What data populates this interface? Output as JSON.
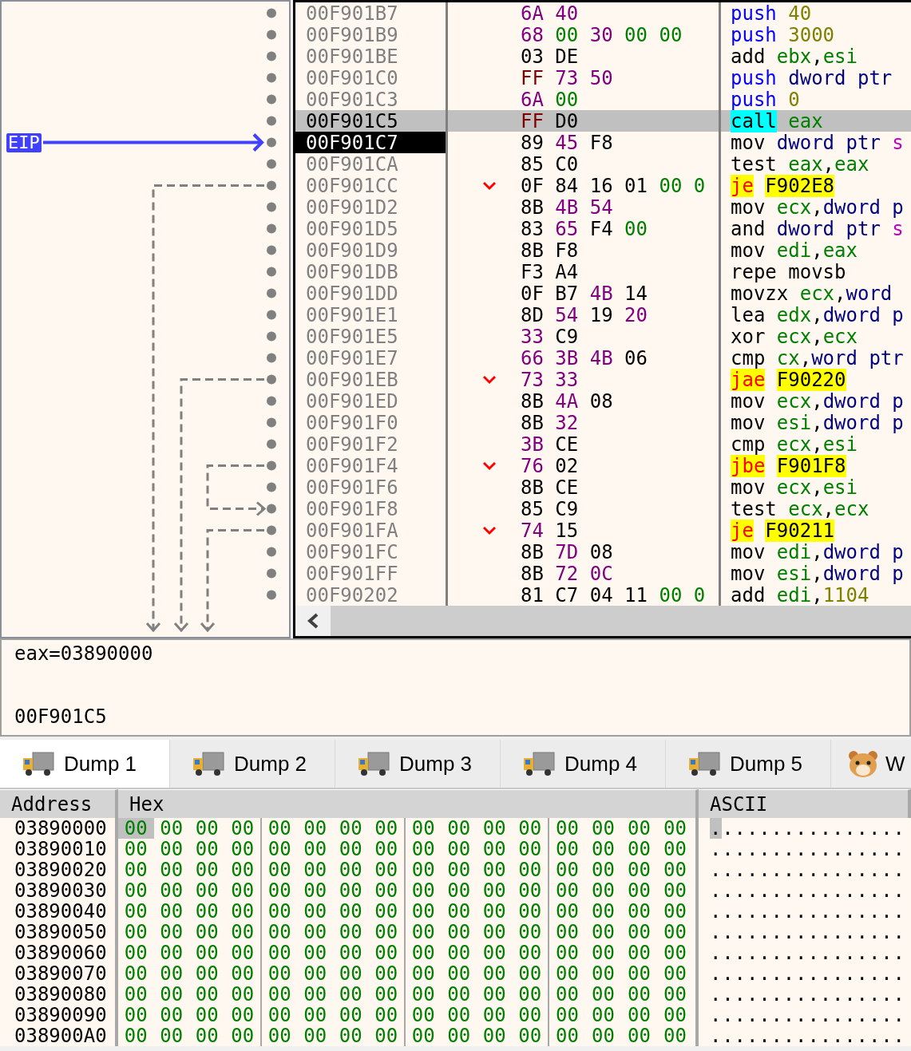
{
  "gutter": {
    "eip_label": "EIP"
  },
  "disassembly": {
    "rows": [
      {
        "address": "00F901B7",
        "selected": false,
        "eip": false,
        "jump": false,
        "bytes": [
          {
            "text": "6A",
            "color": "#800080"
          },
          {
            "text": "40",
            "color": "#800080"
          }
        ],
        "instruction": [
          [
            {
              "text": "push",
              "color": "#0000ff"
            }
          ],
          [
            {
              "text": "40",
              "color": "#808000"
            }
          ]
        ]
      },
      {
        "address": "00F901B9",
        "selected": false,
        "eip": false,
        "jump": false,
        "bytes": [
          {
            "text": "68",
            "color": "#800080"
          },
          {
            "text": "00",
            "color": "#008000"
          },
          {
            "text": "30",
            "color": "#800080"
          },
          {
            "text": "00",
            "color": "#008000"
          },
          {
            "text": "00",
            "color": "#008000"
          }
        ],
        "instruction": [
          [
            {
              "text": "push",
              "color": "#0000ff"
            }
          ],
          [
            {
              "text": "3000",
              "color": "#808000"
            }
          ]
        ]
      },
      {
        "address": "00F901BE",
        "selected": false,
        "eip": false,
        "jump": false,
        "bytes": [
          {
            "text": "03",
            "color": "#000000"
          },
          {
            "text": "DE",
            "color": "#000000"
          }
        ],
        "instruction": [
          [
            {
              "text": "add",
              "color": "#000000"
            }
          ],
          [
            {
              "text": "ebx",
              "color": "#008000"
            },
            {
              "text": ",",
              "color": "#000000"
            },
            {
              "text": "esi",
              "color": "#008000"
            }
          ]
        ]
      },
      {
        "address": "00F901C0",
        "selected": false,
        "eip": false,
        "jump": false,
        "bytes": [
          {
            "text": "FF",
            "color": "#800000"
          },
          {
            "text": "73",
            "color": "#800080"
          },
          {
            "text": "50",
            "color": "#800080"
          }
        ],
        "instruction": [
          [
            {
              "text": "push",
              "color": "#0000ff"
            }
          ],
          [
            {
              "text": "dword",
              "color": "#000080"
            }
          ],
          [
            {
              "text": "ptr",
              "color": "#000080"
            }
          ]
        ]
      },
      {
        "address": "00F901C3",
        "selected": false,
        "eip": false,
        "jump": false,
        "bytes": [
          {
            "text": "6A",
            "color": "#800080"
          },
          {
            "text": "00",
            "color": "#008000"
          }
        ],
        "instruction": [
          [
            {
              "text": "push",
              "color": "#0000ff"
            }
          ],
          [
            {
              "text": "0",
              "color": "#808000"
            }
          ]
        ]
      },
      {
        "address": "00F901C5",
        "selected": true,
        "eip": false,
        "jump": false,
        "bytes": [
          {
            "text": "FF",
            "color": "#800000"
          },
          {
            "text": "D0",
            "color": "#000000"
          }
        ],
        "instruction": [
          [
            {
              "text": "call",
              "kind": "call"
            }
          ],
          [
            {
              "text": "eax",
              "color": "#008000"
            }
          ]
        ]
      },
      {
        "address": "00F901C7",
        "selected": false,
        "eip": true,
        "jump": false,
        "bytes": [
          {
            "text": "89",
            "color": "#000000"
          },
          {
            "text": "45",
            "color": "#800080"
          },
          {
            "text": "F8",
            "color": "#000000"
          }
        ],
        "instruction": [
          [
            {
              "text": "mov",
              "color": "#000000"
            }
          ],
          [
            {
              "text": "dword",
              "color": "#000080"
            }
          ],
          [
            {
              "text": "ptr",
              "color": "#000080"
            }
          ],
          [
            {
              "text": "s",
              "color": "#c000c0"
            }
          ]
        ]
      },
      {
        "address": "00F901CA",
        "selected": false,
        "eip": false,
        "jump": false,
        "bytes": [
          {
            "text": "85",
            "color": "#000000"
          },
          {
            "text": "C0",
            "color": "#000000"
          }
        ],
        "instruction": [
          [
            {
              "text": "test",
              "color": "#000000"
            }
          ],
          [
            {
              "text": "eax",
              "color": "#008000"
            },
            {
              "text": ",",
              "color": "#000000"
            },
            {
              "text": "eax",
              "color": "#008000"
            }
          ]
        ]
      },
      {
        "address": "00F901CC",
        "selected": false,
        "eip": false,
        "jump": true,
        "bytes": [
          {
            "text": "0F",
            "color": "#000000"
          },
          {
            "text": "84",
            "color": "#000000"
          },
          {
            "text": "16",
            "color": "#000000"
          },
          {
            "text": "01",
            "color": "#000000"
          },
          {
            "text": "00",
            "color": "#008000"
          },
          {
            "text": "0",
            "color": "#008000"
          }
        ],
        "instruction": [
          [
            {
              "text": "je",
              "kind": "jump"
            }
          ],
          [
            {
              "text": "F902E8",
              "kind": "target"
            }
          ]
        ]
      },
      {
        "address": "00F901D2",
        "selected": false,
        "eip": false,
        "jump": false,
        "bytes": [
          {
            "text": "8B",
            "color": "#000000"
          },
          {
            "text": "4B",
            "color": "#800080"
          },
          {
            "text": "54",
            "color": "#800080"
          }
        ],
        "instruction": [
          [
            {
              "text": "mov",
              "color": "#000000"
            }
          ],
          [
            {
              "text": "ecx",
              "color": "#008000"
            },
            {
              "text": ",",
              "color": "#000000"
            },
            {
              "text": "dword",
              "color": "#000080"
            }
          ],
          [
            {
              "text": "p",
              "color": "#000080"
            }
          ]
        ]
      },
      {
        "address": "00F901D5",
        "selected": false,
        "eip": false,
        "jump": false,
        "bytes": [
          {
            "text": "83",
            "color": "#000000"
          },
          {
            "text": "65",
            "color": "#800080"
          },
          {
            "text": "F4",
            "color": "#000000"
          },
          {
            "text": "00",
            "color": "#008000"
          }
        ],
        "instruction": [
          [
            {
              "text": "and",
              "color": "#000000"
            }
          ],
          [
            {
              "text": "dword",
              "color": "#000080"
            }
          ],
          [
            {
              "text": "ptr",
              "color": "#000080"
            }
          ],
          [
            {
              "text": "s",
              "color": "#c000c0"
            }
          ]
        ]
      },
      {
        "address": "00F901D9",
        "selected": false,
        "eip": false,
        "jump": false,
        "bytes": [
          {
            "text": "8B",
            "color": "#000000"
          },
          {
            "text": "F8",
            "color": "#000000"
          }
        ],
        "instruction": [
          [
            {
              "text": "mov",
              "color": "#000000"
            }
          ],
          [
            {
              "text": "edi",
              "color": "#008000"
            },
            {
              "text": ",",
              "color": "#000000"
            },
            {
              "text": "eax",
              "color": "#008000"
            }
          ]
        ]
      },
      {
        "address": "00F901DB",
        "selected": false,
        "eip": false,
        "jump": false,
        "bytes": [
          {
            "text": "F3",
            "color": "#000000"
          },
          {
            "text": "A4",
            "color": "#000000"
          }
        ],
        "instruction": [
          [
            {
              "text": "repe",
              "color": "#000000"
            }
          ],
          [
            {
              "text": "movsb",
              "color": "#000000"
            }
          ]
        ]
      },
      {
        "address": "00F901DD",
        "selected": false,
        "eip": false,
        "jump": false,
        "bytes": [
          {
            "text": "0F",
            "color": "#000000"
          },
          {
            "text": "B7",
            "color": "#000000"
          },
          {
            "text": "4B",
            "color": "#800080"
          },
          {
            "text": "14",
            "color": "#000000"
          }
        ],
        "instruction": [
          [
            {
              "text": "movzx",
              "color": "#000000"
            }
          ],
          [
            {
              "text": "ecx",
              "color": "#008000"
            },
            {
              "text": ",",
              "color": "#000000"
            },
            {
              "text": "word",
              "color": "#000080"
            }
          ]
        ]
      },
      {
        "address": "00F901E1",
        "selected": false,
        "eip": false,
        "jump": false,
        "bytes": [
          {
            "text": "8D",
            "color": "#000000"
          },
          {
            "text": "54",
            "color": "#800080"
          },
          {
            "text": "19",
            "color": "#000000"
          },
          {
            "text": "20",
            "color": "#800080"
          }
        ],
        "instruction": [
          [
            {
              "text": "lea",
              "color": "#000000"
            }
          ],
          [
            {
              "text": "edx",
              "color": "#008000"
            },
            {
              "text": ",",
              "color": "#000000"
            },
            {
              "text": "dword",
              "color": "#000080"
            }
          ],
          [
            {
              "text": "p",
              "color": "#000080"
            }
          ]
        ]
      },
      {
        "address": "00F901E5",
        "selected": false,
        "eip": false,
        "jump": false,
        "bytes": [
          {
            "text": "33",
            "color": "#800080"
          },
          {
            "text": "C9",
            "color": "#000000"
          }
        ],
        "instruction": [
          [
            {
              "text": "xor",
              "color": "#000000"
            }
          ],
          [
            {
              "text": "ecx",
              "color": "#008000"
            },
            {
              "text": ",",
              "color": "#000000"
            },
            {
              "text": "ecx",
              "color": "#008000"
            }
          ]
        ]
      },
      {
        "address": "00F901E7",
        "selected": false,
        "eip": false,
        "jump": false,
        "bytes": [
          {
            "text": "66",
            "color": "#800080"
          },
          {
            "text": "3B",
            "color": "#800080"
          },
          {
            "text": "4B",
            "color": "#800080"
          },
          {
            "text": "06",
            "color": "#000000"
          }
        ],
        "instruction": [
          [
            {
              "text": "cmp",
              "color": "#000000"
            }
          ],
          [
            {
              "text": "cx",
              "color": "#008000"
            },
            {
              "text": ",",
              "color": "#000000"
            },
            {
              "text": "word",
              "color": "#000080"
            }
          ],
          [
            {
              "text": "ptr",
              "color": "#000080"
            }
          ]
        ]
      },
      {
        "address": "00F901EB",
        "selected": false,
        "eip": false,
        "jump": true,
        "bytes": [
          {
            "text": "73",
            "color": "#800080"
          },
          {
            "text": "33",
            "color": "#800080"
          }
        ],
        "instruction": [
          [
            {
              "text": "jae",
              "kind": "jump"
            }
          ],
          [
            {
              "text": "F90220",
              "kind": "target"
            }
          ]
        ]
      },
      {
        "address": "00F901ED",
        "selected": false,
        "eip": false,
        "jump": false,
        "bytes": [
          {
            "text": "8B",
            "color": "#000000"
          },
          {
            "text": "4A",
            "color": "#800080"
          },
          {
            "text": "08",
            "color": "#000000"
          }
        ],
        "instruction": [
          [
            {
              "text": "mov",
              "color": "#000000"
            }
          ],
          [
            {
              "text": "ecx",
              "color": "#008000"
            },
            {
              "text": ",",
              "color": "#000000"
            },
            {
              "text": "dword",
              "color": "#000080"
            }
          ],
          [
            {
              "text": "p",
              "color": "#000080"
            }
          ]
        ]
      },
      {
        "address": "00F901F0",
        "selected": false,
        "eip": false,
        "jump": false,
        "bytes": [
          {
            "text": "8B",
            "color": "#000000"
          },
          {
            "text": "32",
            "color": "#800080"
          }
        ],
        "instruction": [
          [
            {
              "text": "mov",
              "color": "#000000"
            }
          ],
          [
            {
              "text": "esi",
              "color": "#008000"
            },
            {
              "text": ",",
              "color": "#000000"
            },
            {
              "text": "dword",
              "color": "#000080"
            }
          ],
          [
            {
              "text": "p",
              "color": "#000080"
            }
          ]
        ]
      },
      {
        "address": "00F901F2",
        "selected": false,
        "eip": false,
        "jump": false,
        "bytes": [
          {
            "text": "3B",
            "color": "#800080"
          },
          {
            "text": "CE",
            "color": "#000000"
          }
        ],
        "instruction": [
          [
            {
              "text": "cmp",
              "color": "#000000"
            }
          ],
          [
            {
              "text": "ecx",
              "color": "#008000"
            },
            {
              "text": ",",
              "color": "#000000"
            },
            {
              "text": "esi",
              "color": "#008000"
            }
          ]
        ]
      },
      {
        "address": "00F901F4",
        "selected": false,
        "eip": false,
        "jump": true,
        "bytes": [
          {
            "text": "76",
            "color": "#800080"
          },
          {
            "text": "02",
            "color": "#000000"
          }
        ],
        "instruction": [
          [
            {
              "text": "jbe",
              "kind": "jump"
            }
          ],
          [
            {
              "text": "F901F8",
              "kind": "target"
            }
          ]
        ]
      },
      {
        "address": "00F901F6",
        "selected": false,
        "eip": false,
        "jump": false,
        "bytes": [
          {
            "text": "8B",
            "color": "#000000"
          },
          {
            "text": "CE",
            "color": "#000000"
          }
        ],
        "instruction": [
          [
            {
              "text": "mov",
              "color": "#000000"
            }
          ],
          [
            {
              "text": "ecx",
              "color": "#008000"
            },
            {
              "text": ",",
              "color": "#000000"
            },
            {
              "text": "esi",
              "color": "#008000"
            }
          ]
        ]
      },
      {
        "address": "00F901F8",
        "selected": false,
        "eip": false,
        "jump": false,
        "bytes": [
          {
            "text": "85",
            "color": "#000000"
          },
          {
            "text": "C9",
            "color": "#000000"
          }
        ],
        "instruction": [
          [
            {
              "text": "test",
              "color": "#000000"
            }
          ],
          [
            {
              "text": "ecx",
              "color": "#008000"
            },
            {
              "text": ",",
              "color": "#000000"
            },
            {
              "text": "ecx",
              "color": "#008000"
            }
          ]
        ]
      },
      {
        "address": "00F901FA",
        "selected": false,
        "eip": false,
        "jump": true,
        "bytes": [
          {
            "text": "74",
            "color": "#800080"
          },
          {
            "text": "15",
            "color": "#000000"
          }
        ],
        "instruction": [
          [
            {
              "text": "je",
              "kind": "jump"
            }
          ],
          [
            {
              "text": "F90211",
              "kind": "target"
            }
          ]
        ]
      },
      {
        "address": "00F901FC",
        "selected": false,
        "eip": false,
        "jump": false,
        "bytes": [
          {
            "text": "8B",
            "color": "#000000"
          },
          {
            "text": "7D",
            "color": "#800080"
          },
          {
            "text": "08",
            "color": "#000000"
          }
        ],
        "instruction": [
          [
            {
              "text": "mov",
              "color": "#000000"
            }
          ],
          [
            {
              "text": "edi",
              "color": "#008000"
            },
            {
              "text": ",",
              "color": "#000000"
            },
            {
              "text": "dword",
              "color": "#000080"
            }
          ],
          [
            {
              "text": "p",
              "color": "#000080"
            }
          ]
        ]
      },
      {
        "address": "00F901FF",
        "selected": false,
        "eip": false,
        "jump": false,
        "bytes": [
          {
            "text": "8B",
            "color": "#000000"
          },
          {
            "text": "72",
            "color": "#800080"
          },
          {
            "text": "0C",
            "color": "#800080"
          }
        ],
        "instruction": [
          [
            {
              "text": "mov",
              "color": "#000000"
            }
          ],
          [
            {
              "text": "esi",
              "color": "#008000"
            },
            {
              "text": ",",
              "color": "#000000"
            },
            {
              "text": "dword",
              "color": "#000080"
            }
          ],
          [
            {
              "text": "p",
              "color": "#000080"
            }
          ]
        ]
      },
      {
        "address": "00F90202",
        "selected": false,
        "eip": false,
        "jump": false,
        "bytes": [
          {
            "text": "81",
            "color": "#000000"
          },
          {
            "text": "C7",
            "color": "#000000"
          },
          {
            "text": "04",
            "color": "#000000"
          },
          {
            "text": "11",
            "color": "#000000"
          },
          {
            "text": "00",
            "color": "#008000"
          },
          {
            "text": "0",
            "color": "#008000"
          }
        ],
        "instruction": [
          [
            {
              "text": "add",
              "color": "#000000"
            }
          ],
          [
            {
              "text": "edi",
              "color": "#008000"
            },
            {
              "text": ",",
              "color": "#000000"
            },
            {
              "text": "1104",
              "color": "#808000"
            }
          ]
        ]
      }
    ]
  },
  "info": {
    "lines": [
      "eax=03890000",
      "00F901C5"
    ]
  },
  "tabs": [
    {
      "label": "Dump 1",
      "kind": "dump",
      "selected": true
    },
    {
      "label": "Dump 2",
      "kind": "dump",
      "selected": false
    },
    {
      "label": "Dump 3",
      "kind": "dump",
      "selected": false
    },
    {
      "label": "Dump 4",
      "kind": "dump",
      "selected": false
    },
    {
      "label": "Dump 5",
      "kind": "dump",
      "selected": false
    },
    {
      "label": "W",
      "kind": "watch",
      "selected": false
    }
  ],
  "dump": {
    "columns": [
      "Address",
      "Hex",
      "ASCII"
    ],
    "rows": [
      {
        "address": "03890000",
        "ascii": "................",
        "bytes": [
          {
            "text": "00",
            "selected": true
          },
          {
            "text": "00",
            "selected": false
          },
          {
            "text": "00",
            "selected": false
          },
          {
            "text": "00",
            "selected": false
          },
          {
            "text": "00",
            "selected": false
          },
          {
            "text": "00",
            "selected": false
          },
          {
            "text": "00",
            "selected": false
          },
          {
            "text": "00",
            "selected": false
          },
          {
            "text": "00",
            "selected": false
          },
          {
            "text": "00",
            "selected": false
          },
          {
            "text": "00",
            "selected": false
          },
          {
            "text": "00",
            "selected": false
          },
          {
            "text": "00",
            "selected": false
          },
          {
            "text": "00",
            "selected": false
          },
          {
            "text": "00",
            "selected": false
          },
          {
            "text": "00",
            "selected": false
          }
        ]
      },
      {
        "address": "03890010",
        "ascii": "................",
        "bytes": [
          {
            "text": "00",
            "selected": false
          },
          {
            "text": "00",
            "selected": false
          },
          {
            "text": "00",
            "selected": false
          },
          {
            "text": "00",
            "selected": false
          },
          {
            "text": "00",
            "selected": false
          },
          {
            "text": "00",
            "selected": false
          },
          {
            "text": "00",
            "selected": false
          },
          {
            "text": "00",
            "selected": false
          },
          {
            "text": "00",
            "selected": false
          },
          {
            "text": "00",
            "selected": false
          },
          {
            "text": "00",
            "selected": false
          },
          {
            "text": "00",
            "selected": false
          },
          {
            "text": "00",
            "selected": false
          },
          {
            "text": "00",
            "selected": false
          },
          {
            "text": "00",
            "selected": false
          },
          {
            "text": "00",
            "selected": false
          }
        ]
      },
      {
        "address": "03890020",
        "ascii": "................",
        "bytes": [
          {
            "text": "00",
            "selected": false
          },
          {
            "text": "00",
            "selected": false
          },
          {
            "text": "00",
            "selected": false
          },
          {
            "text": "00",
            "selected": false
          },
          {
            "text": "00",
            "selected": false
          },
          {
            "text": "00",
            "selected": false
          },
          {
            "text": "00",
            "selected": false
          },
          {
            "text": "00",
            "selected": false
          },
          {
            "text": "00",
            "selected": false
          },
          {
            "text": "00",
            "selected": false
          },
          {
            "text": "00",
            "selected": false
          },
          {
            "text": "00",
            "selected": false
          },
          {
            "text": "00",
            "selected": false
          },
          {
            "text": "00",
            "selected": false
          },
          {
            "text": "00",
            "selected": false
          },
          {
            "text": "00",
            "selected": false
          }
        ]
      },
      {
        "address": "03890030",
        "ascii": "................",
        "bytes": [
          {
            "text": "00",
            "selected": false
          },
          {
            "text": "00",
            "selected": false
          },
          {
            "text": "00",
            "selected": false
          },
          {
            "text": "00",
            "selected": false
          },
          {
            "text": "00",
            "selected": false
          },
          {
            "text": "00",
            "selected": false
          },
          {
            "text": "00",
            "selected": false
          },
          {
            "text": "00",
            "selected": false
          },
          {
            "text": "00",
            "selected": false
          },
          {
            "text": "00",
            "selected": false
          },
          {
            "text": "00",
            "selected": false
          },
          {
            "text": "00",
            "selected": false
          },
          {
            "text": "00",
            "selected": false
          },
          {
            "text": "00",
            "selected": false
          },
          {
            "text": "00",
            "selected": false
          },
          {
            "text": "00",
            "selected": false
          }
        ]
      },
      {
        "address": "03890040",
        "ascii": "................",
        "bytes": [
          {
            "text": "00",
            "selected": false
          },
          {
            "text": "00",
            "selected": false
          },
          {
            "text": "00",
            "selected": false
          },
          {
            "text": "00",
            "selected": false
          },
          {
            "text": "00",
            "selected": false
          },
          {
            "text": "00",
            "selected": false
          },
          {
            "text": "00",
            "selected": false
          },
          {
            "text": "00",
            "selected": false
          },
          {
            "text": "00",
            "selected": false
          },
          {
            "text": "00",
            "selected": false
          },
          {
            "text": "00",
            "selected": false
          },
          {
            "text": "00",
            "selected": false
          },
          {
            "text": "00",
            "selected": false
          },
          {
            "text": "00",
            "selected": false
          },
          {
            "text": "00",
            "selected": false
          },
          {
            "text": "00",
            "selected": false
          }
        ]
      },
      {
        "address": "03890050",
        "ascii": "................",
        "bytes": [
          {
            "text": "00",
            "selected": false
          },
          {
            "text": "00",
            "selected": false
          },
          {
            "text": "00",
            "selected": false
          },
          {
            "text": "00",
            "selected": false
          },
          {
            "text": "00",
            "selected": false
          },
          {
            "text": "00",
            "selected": false
          },
          {
            "text": "00",
            "selected": false
          },
          {
            "text": "00",
            "selected": false
          },
          {
            "text": "00",
            "selected": false
          },
          {
            "text": "00",
            "selected": false
          },
          {
            "text": "00",
            "selected": false
          },
          {
            "text": "00",
            "selected": false
          },
          {
            "text": "00",
            "selected": false
          },
          {
            "text": "00",
            "selected": false
          },
          {
            "text": "00",
            "selected": false
          },
          {
            "text": "00",
            "selected": false
          }
        ]
      },
      {
        "address": "03890060",
        "ascii": "................",
        "bytes": [
          {
            "text": "00",
            "selected": false
          },
          {
            "text": "00",
            "selected": false
          },
          {
            "text": "00",
            "selected": false
          },
          {
            "text": "00",
            "selected": false
          },
          {
            "text": "00",
            "selected": false
          },
          {
            "text": "00",
            "selected": false
          },
          {
            "text": "00",
            "selected": false
          },
          {
            "text": "00",
            "selected": false
          },
          {
            "text": "00",
            "selected": false
          },
          {
            "text": "00",
            "selected": false
          },
          {
            "text": "00",
            "selected": false
          },
          {
            "text": "00",
            "selected": false
          },
          {
            "text": "00",
            "selected": false
          },
          {
            "text": "00",
            "selected": false
          },
          {
            "text": "00",
            "selected": false
          },
          {
            "text": "00",
            "selected": false
          }
        ]
      },
      {
        "address": "03890070",
        "ascii": "................",
        "bytes": [
          {
            "text": "00",
            "selected": false
          },
          {
            "text": "00",
            "selected": false
          },
          {
            "text": "00",
            "selected": false
          },
          {
            "text": "00",
            "selected": false
          },
          {
            "text": "00",
            "selected": false
          },
          {
            "text": "00",
            "selected": false
          },
          {
            "text": "00",
            "selected": false
          },
          {
            "text": "00",
            "selected": false
          },
          {
            "text": "00",
            "selected": false
          },
          {
            "text": "00",
            "selected": false
          },
          {
            "text": "00",
            "selected": false
          },
          {
            "text": "00",
            "selected": false
          },
          {
            "text": "00",
            "selected": false
          },
          {
            "text": "00",
            "selected": false
          },
          {
            "text": "00",
            "selected": false
          },
          {
            "text": "00",
            "selected": false
          }
        ]
      },
      {
        "address": "03890080",
        "ascii": "................",
        "bytes": [
          {
            "text": "00",
            "selected": false
          },
          {
            "text": "00",
            "selected": false
          },
          {
            "text": "00",
            "selected": false
          },
          {
            "text": "00",
            "selected": false
          },
          {
            "text": "00",
            "selected": false
          },
          {
            "text": "00",
            "selected": false
          },
          {
            "text": "00",
            "selected": false
          },
          {
            "text": "00",
            "selected": false
          },
          {
            "text": "00",
            "selected": false
          },
          {
            "text": "00",
            "selected": false
          },
          {
            "text": "00",
            "selected": false
          },
          {
            "text": "00",
            "selected": false
          },
          {
            "text": "00",
            "selected": false
          },
          {
            "text": "00",
            "selected": false
          },
          {
            "text": "00",
            "selected": false
          },
          {
            "text": "00",
            "selected": false
          }
        ]
      },
      {
        "address": "03890090",
        "ascii": "................",
        "bytes": [
          {
            "text": "00",
            "selected": false
          },
          {
            "text": "00",
            "selected": false
          },
          {
            "text": "00",
            "selected": false
          },
          {
            "text": "00",
            "selected": false
          },
          {
            "text": "00",
            "selected": false
          },
          {
            "text": "00",
            "selected": false
          },
          {
            "text": "00",
            "selected": false
          },
          {
            "text": "00",
            "selected": false
          },
          {
            "text": "00",
            "selected": false
          },
          {
            "text": "00",
            "selected": false
          },
          {
            "text": "00",
            "selected": false
          },
          {
            "text": "00",
            "selected": false
          },
          {
            "text": "00",
            "selected": false
          },
          {
            "text": "00",
            "selected": false
          },
          {
            "text": "00",
            "selected": false
          },
          {
            "text": "00",
            "selected": false
          }
        ]
      },
      {
        "address": "038900A0",
        "ascii": "................",
        "bytes": [
          {
            "text": "00",
            "selected": false
          },
          {
            "text": "00",
            "selected": false
          },
          {
            "text": "00",
            "selected": false
          },
          {
            "text": "00",
            "selected": false
          },
          {
            "text": "00",
            "selected": false
          },
          {
            "text": "00",
            "selected": false
          },
          {
            "text": "00",
            "selected": false
          },
          {
            "text": "00",
            "selected": false
          },
          {
            "text": "00",
            "selected": false
          },
          {
            "text": "00",
            "selected": false
          },
          {
            "text": "00",
            "selected": false
          },
          {
            "text": "00",
            "selected": false
          },
          {
            "text": "00",
            "selected": false
          },
          {
            "text": "00",
            "selected": false
          },
          {
            "text": "00",
            "selected": false
          },
          {
            "text": "00",
            "selected": false
          }
        ]
      }
    ]
  }
}
